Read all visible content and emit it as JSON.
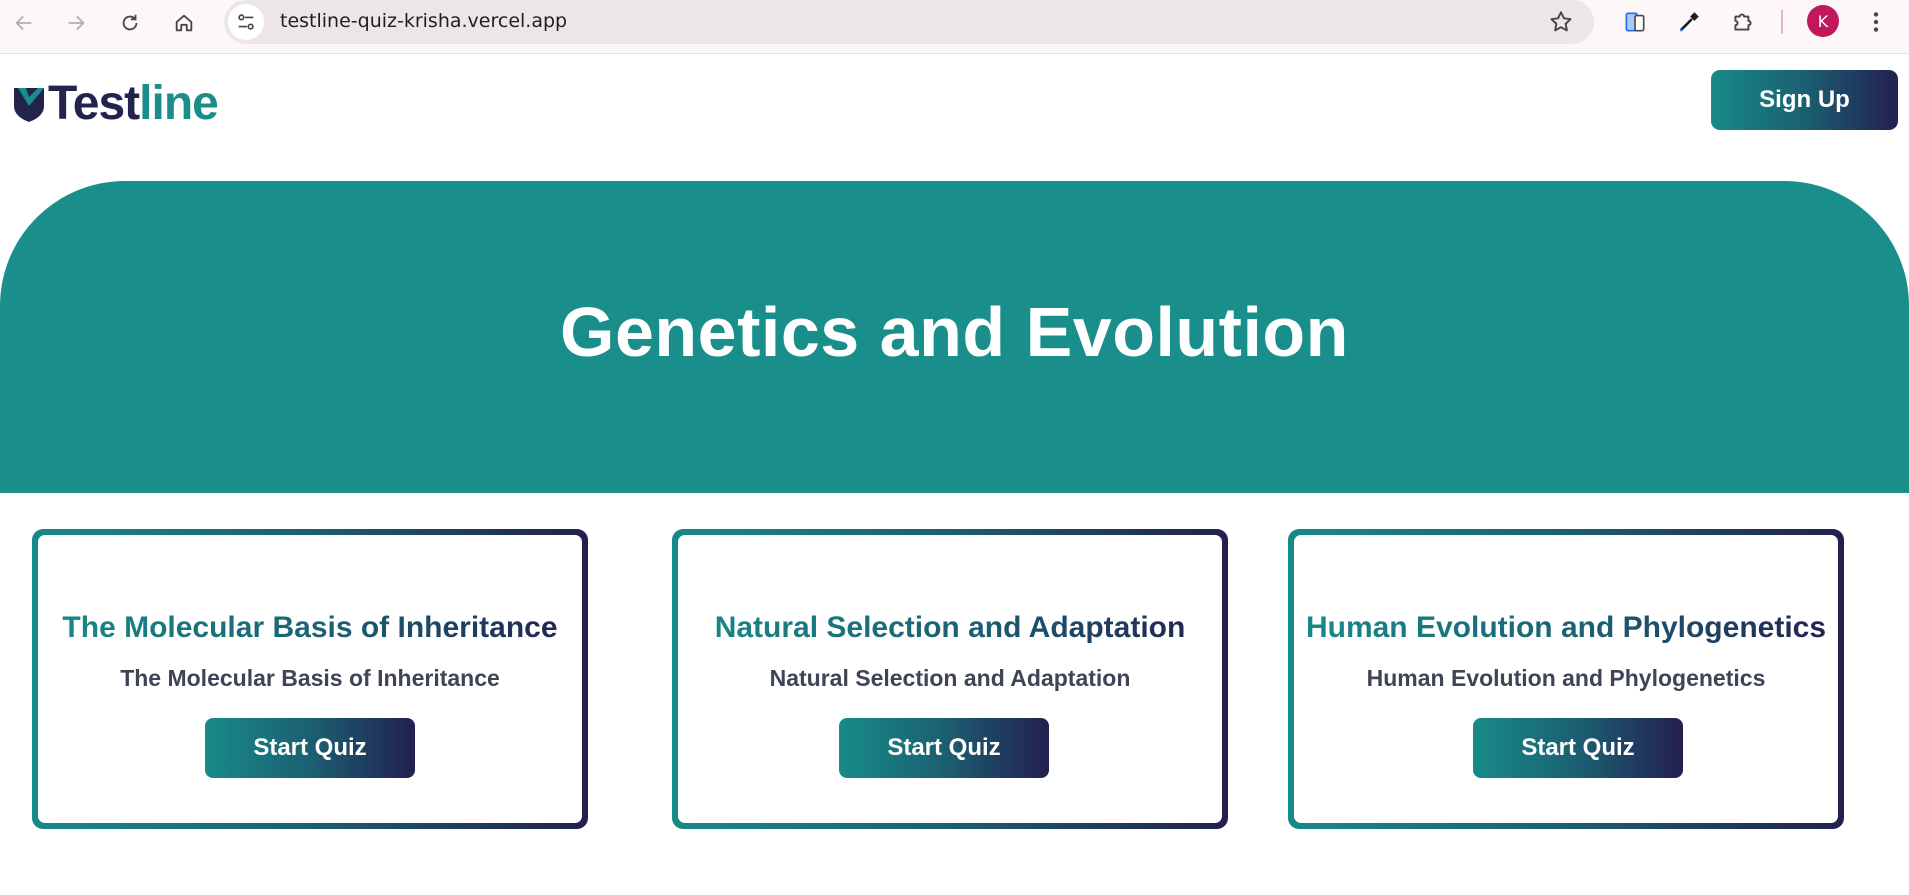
{
  "browser": {
    "url": "testline-quiz-krisha.vercel.app",
    "avatar_letter": "K",
    "avatar_color": "#c2185b"
  },
  "header": {
    "logo_part1": "Test",
    "logo_part2": "line",
    "signup_label": "Sign Up"
  },
  "hero": {
    "title": "Genetics and Evolution",
    "background": "#198e8b"
  },
  "cards": [
    {
      "title": "The Molecular Basis of Inheritance",
      "subtitle": "The Molecular Basis of Inheritance",
      "button_label": "Start Quiz"
    },
    {
      "title": "Natural Selection and Adaptation",
      "subtitle": "Natural Selection and Adaptation",
      "button_label": "Start Quiz"
    },
    {
      "title": "Human Evolution and Phylogenetics",
      "subtitle": "Human Evolution and Phylogenetics",
      "button_label": "Start Quiz"
    }
  ],
  "colors": {
    "brand_teal": "#178b88",
    "brand_navy": "#23204f"
  }
}
